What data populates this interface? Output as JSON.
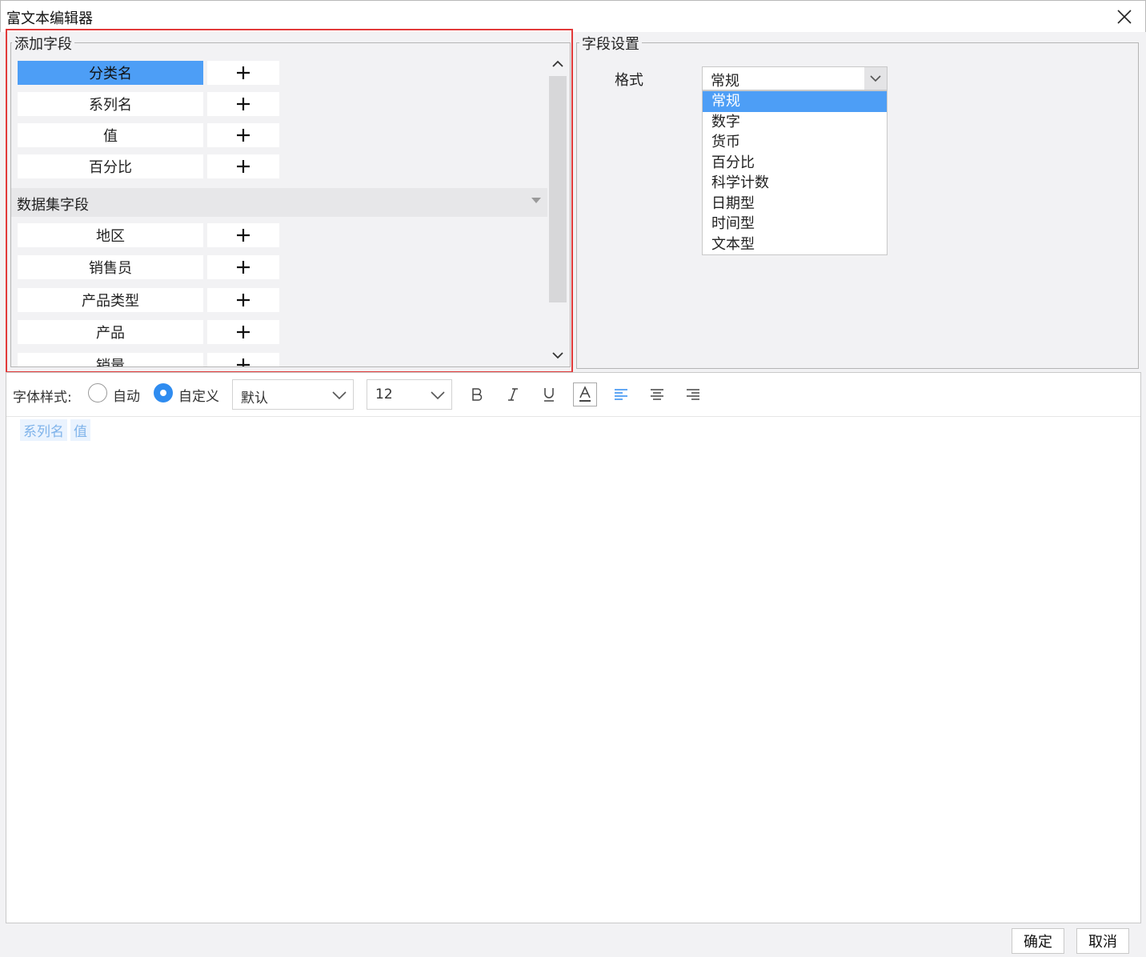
{
  "window": {
    "title": "富文本编辑器"
  },
  "add_fields": {
    "title": "添加字段",
    "chart_fields": [
      "分类名",
      "系列名",
      "值",
      "百分比"
    ],
    "dataset_section": "数据集字段",
    "dataset_fields": [
      "地区",
      "销售员",
      "产品类型",
      "产品",
      "销量"
    ]
  },
  "field_settings": {
    "title": "字段设置",
    "format_label": "格式",
    "format_value": "常规",
    "format_options": [
      "常规",
      "数字",
      "货币",
      "百分比",
      "科学计数",
      "日期型",
      "时间型",
      "文本型"
    ]
  },
  "toolbar": {
    "font_style_label": "字体样式:",
    "radio_auto": "自动",
    "radio_custom": "自定义",
    "font_family": "默认",
    "font_size": "12"
  },
  "editor": {
    "tags": [
      "系列名",
      "值"
    ]
  },
  "footer": {
    "ok": "确定",
    "cancel": "取消"
  },
  "colors": {
    "accent": "#4d9ef6",
    "highlight_border": "#e23a3a",
    "radio_checked": "#2f8cf0",
    "tag_text": "#7fb3ea"
  }
}
